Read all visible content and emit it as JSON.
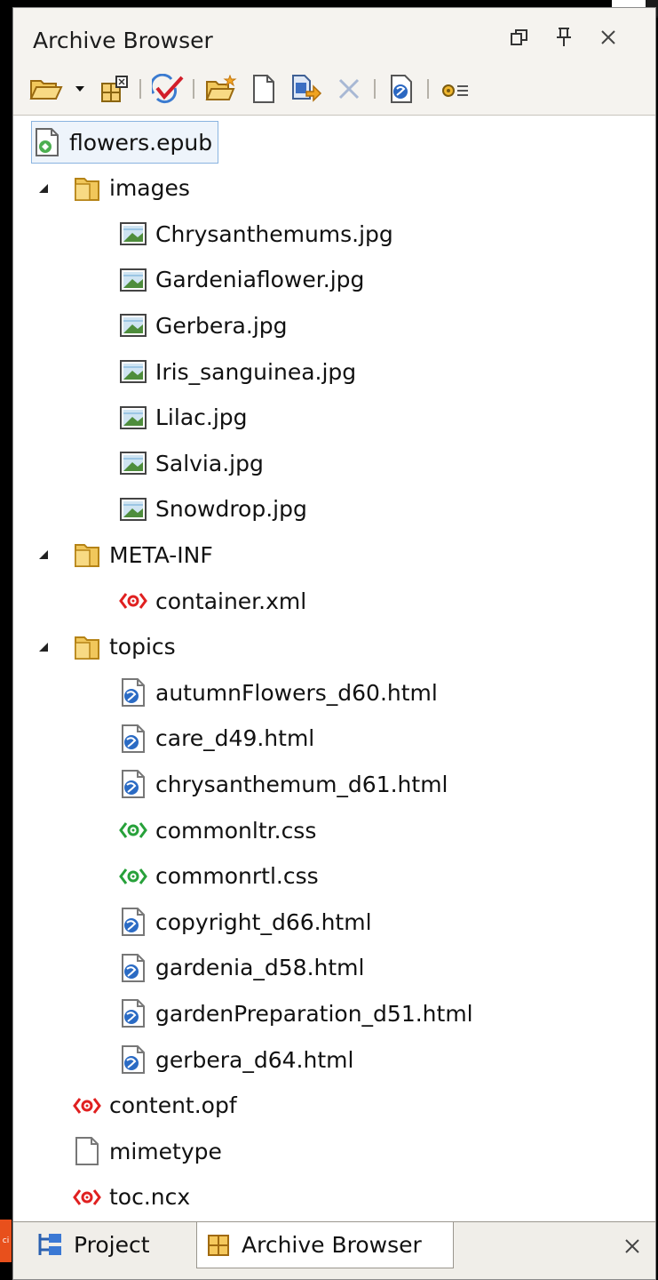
{
  "panel": {
    "title": "Archive Browser",
    "controls": {
      "restore": "⧉",
      "pin": "↕",
      "close": "×"
    }
  },
  "toolbar": {
    "buttons": [
      {
        "name": "open-archive-icon"
      },
      {
        "name": "dropdown-arrow-icon"
      },
      {
        "name": "new-archive-icon"
      },
      {
        "name": "validate-icon"
      },
      {
        "name": "new-folder-icon"
      },
      {
        "name": "new-file-icon"
      },
      {
        "name": "rename-icon"
      },
      {
        "name": "delete-icon"
      },
      {
        "name": "properties-icon"
      },
      {
        "name": "settings-icon"
      }
    ]
  },
  "tree": {
    "root": "flowers.epub",
    "folders": {
      "images": "images",
      "meta_inf": "META-INF",
      "topics": "topics"
    },
    "images_files": [
      "Chrysanthemums.jpg",
      "Gardeniaflower.jpg",
      "Gerbera.jpg",
      "Iris_sanguinea.jpg",
      "Lilac.jpg",
      "Salvia.jpg",
      "Snowdrop.jpg"
    ],
    "meta_inf_files": [
      "container.xml"
    ],
    "topics_files": [
      "autumnFlowers_d60.html",
      "care_d49.html",
      "chrysanthemum_d61.html",
      "commonltr.css",
      "commonrtl.css",
      "copyright_d66.html",
      "gardenia_d58.html",
      "gardenPreparation_d51.html",
      "gerbera_d64.html"
    ],
    "root_files": [
      "content.opf",
      "mimetype",
      "toc.ncx"
    ]
  },
  "bottom_tabs": {
    "project": "Project",
    "archive_browser": "Archive Browser",
    "close": "×"
  },
  "colors": {
    "selection_bg": "#eef4fb",
    "selection_border": "#8ab4e0",
    "panel_bg": "#f5f3ef",
    "tree_bg": "#ffffff",
    "xml_red": "#e02020",
    "css_green": "#27a13a",
    "html_blue": "#2b6bc4"
  }
}
